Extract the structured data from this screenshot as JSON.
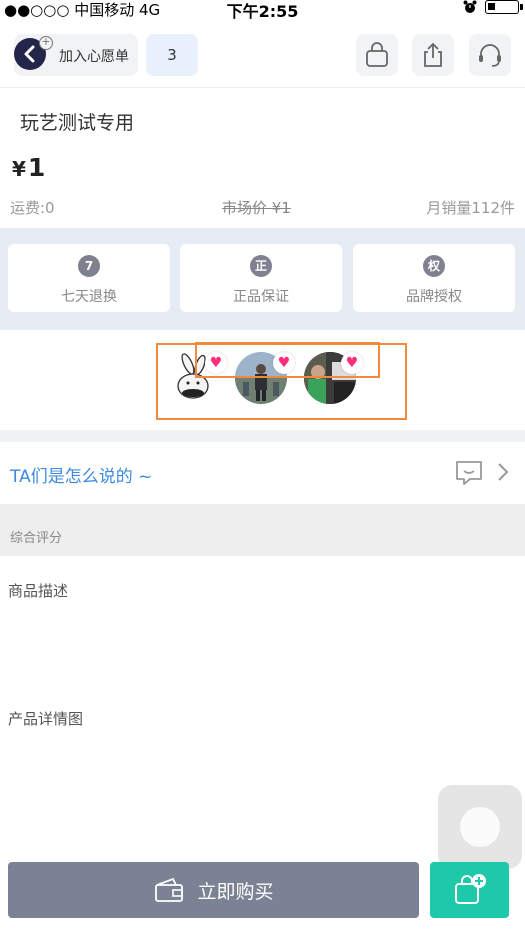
{
  "status_bar": {
    "carrier": "●●○○○ 中国移动   4G",
    "time": "下午2:55",
    "alarm_icon": "alarm-icon",
    "battery_level": 0.25
  },
  "header": {
    "wishlist_label": "加入心愿单",
    "wishlist_count": "3",
    "icons": [
      "shopping-bag-icon",
      "share-icon",
      "customer-service-icon"
    ]
  },
  "product": {
    "title": "玩艺测试专用",
    "price_symbol": "¥",
    "price": "1",
    "shipping": "运费:0",
    "market_price": "市场价  ¥1",
    "monthly_sales": "月销量112件"
  },
  "guarantees": [
    {
      "icon_char": "7",
      "label": "七天退换"
    },
    {
      "icon_char": "正",
      "label": "正品保证"
    },
    {
      "icon_char": "权",
      "label": "品牌授权"
    }
  ],
  "liked_by": {
    "heart_glyph": "♥",
    "avatars": [
      "avatar-rabbit",
      "avatar-person-outdoor",
      "avatar-person-car"
    ]
  },
  "comments": {
    "label": "TA们是怎么说的 ~"
  },
  "rating": {
    "label": "综合评分"
  },
  "sections": {
    "description": "商品描述",
    "detail_images": "产品详情图"
  },
  "bottom_bar": {
    "buy_label": "立即购买"
  },
  "colors": {
    "accent_blue": "#3d8be0",
    "cart_green": "#1ec9a9",
    "buy_gray": "#7b8294",
    "heart_pink": "#ff2d7a",
    "selection_orange": "#f08a3c"
  }
}
